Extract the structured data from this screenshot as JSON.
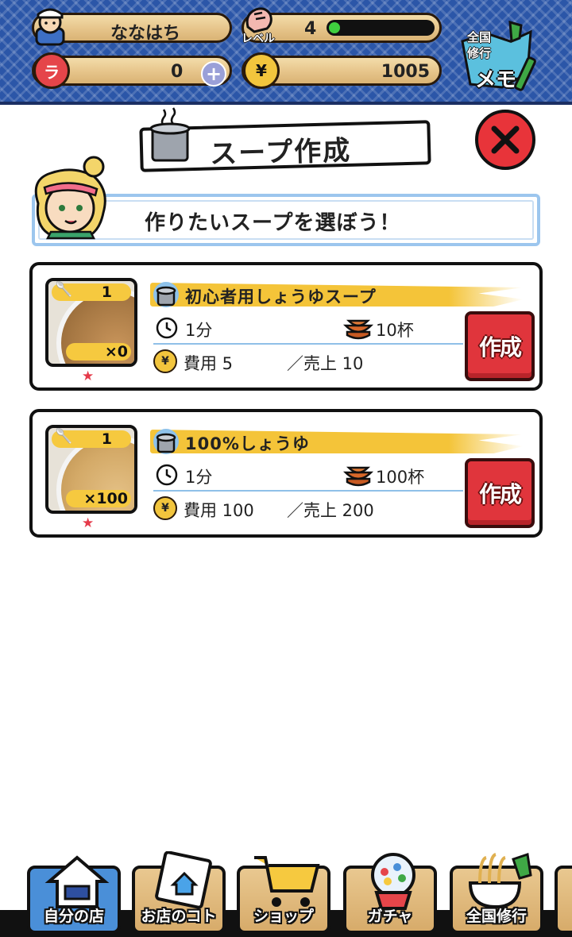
{
  "player": {
    "name": "ななはち",
    "level_label": "レベル",
    "level": "4",
    "level_progress": 0.1,
    "ramen_tickets": "0",
    "coins": "1005",
    "coin_symbol": "¥",
    "ticket_symbol": "ラ"
  },
  "memo": {
    "line1": "全国",
    "line2": "修行",
    "line3": "メモ"
  },
  "title": "スープ作成",
  "instruction": "作りたいスープを選ぼう！",
  "recipes": [
    {
      "name": "初心者用しょうゆスープ",
      "thumb_count": "1",
      "stock": "×0",
      "stars": "★",
      "time": "1分",
      "servings": "10杯",
      "cost": "費用 5",
      "sales": "／売上 10",
      "button": "作成"
    },
    {
      "name": "100%しょうゆ",
      "thumb_count": "1",
      "stock": "×100",
      "stars": "★",
      "time": "1分",
      "servings": "100杯",
      "cost": "費用 100",
      "sales": "／売上 200",
      "button": "作成"
    }
  ],
  "nav": [
    {
      "label": "自分の店",
      "icon": "shop-house-icon"
    },
    {
      "label": "お店のコト",
      "icon": "shop-info-icon"
    },
    {
      "label": "ショップ",
      "icon": "cart-icon"
    },
    {
      "label": "ガチャ",
      "icon": "gacha-bowl-icon"
    },
    {
      "label": "全国修行",
      "icon": "japan-map-icon"
    }
  ],
  "colors": {
    "header_blue": "#2b56a8",
    "plank": "#e6c48a",
    "level_green": "#3fcf3f",
    "stripe_yellow": "#f4c439",
    "make_red": "#e0353c",
    "close_red": "#e8343a"
  }
}
